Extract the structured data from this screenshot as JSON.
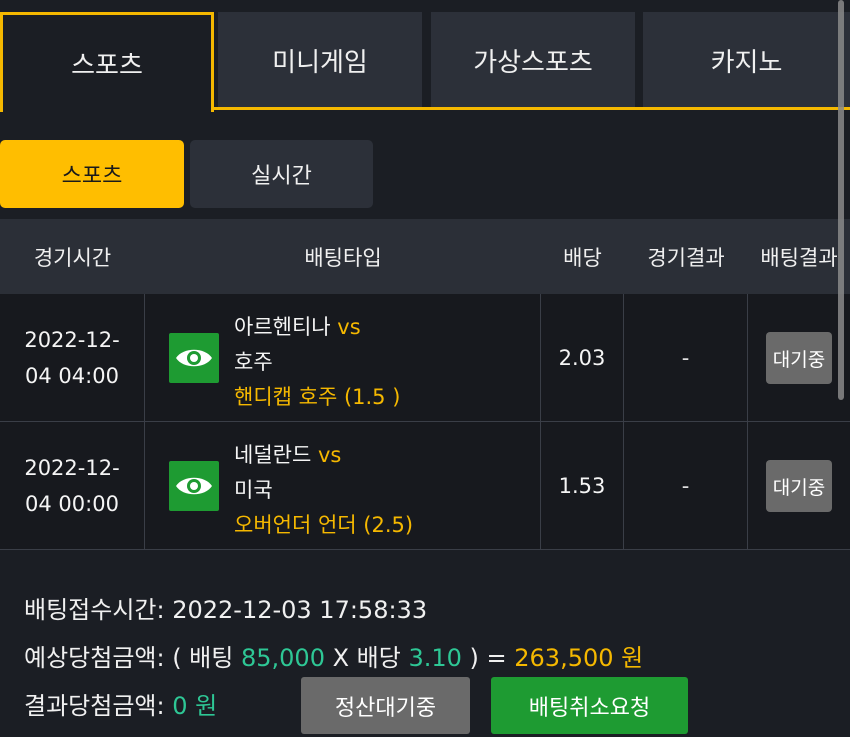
{
  "top_tabs": [
    {
      "label": "스포츠"
    },
    {
      "label": "미니게임"
    },
    {
      "label": "가상스포츠"
    },
    {
      "label": "카지노"
    }
  ],
  "sub_tabs": [
    {
      "label": "스포츠"
    },
    {
      "label": "실시간"
    }
  ],
  "table": {
    "headers": [
      "경기시간",
      "배팅타입",
      "배당",
      "경기결과",
      "배팅결과"
    ],
    "rows": [
      {
        "time_line1": "2022-12-",
        "time_line2": "04 04:00",
        "team1": "아르헨티나",
        "vs": "vs",
        "team2": "호주",
        "bet_type": "핸디캡 호주 (1.5 )",
        "odds": "2.03",
        "result": "-",
        "status": "대기중"
      },
      {
        "time_line1": "2022-12-",
        "time_line2": "04 00:00",
        "team1": "네덜란드",
        "vs": "vs",
        "team2": "미국",
        "bet_type": "오버언더 언더 (2.5)",
        "odds": "1.53",
        "result": "-",
        "status": "대기중"
      }
    ]
  },
  "summary": {
    "received_label": "배팅접수시간: ",
    "received_value": "2022-12-03 17:58:33",
    "expected_label": "예상당첨금액: ( 배팅 ",
    "expected_bet": "85,000",
    "expected_x": " X 배당 ",
    "expected_odds": "3.10",
    "expected_eq": " ) = ",
    "expected_total": "263,500 원",
    "result_label": "결과당첨금액: ",
    "result_value": "0 원"
  },
  "buttons": {
    "settle": "정산대기중",
    "cancel": "배팅취소요청"
  },
  "colors": {
    "accent": "#f5b800",
    "green_button": "#1e9b32",
    "green_text": "#2ec795",
    "background": "#1b1e24"
  },
  "icons": {
    "view": "eye-icon"
  }
}
